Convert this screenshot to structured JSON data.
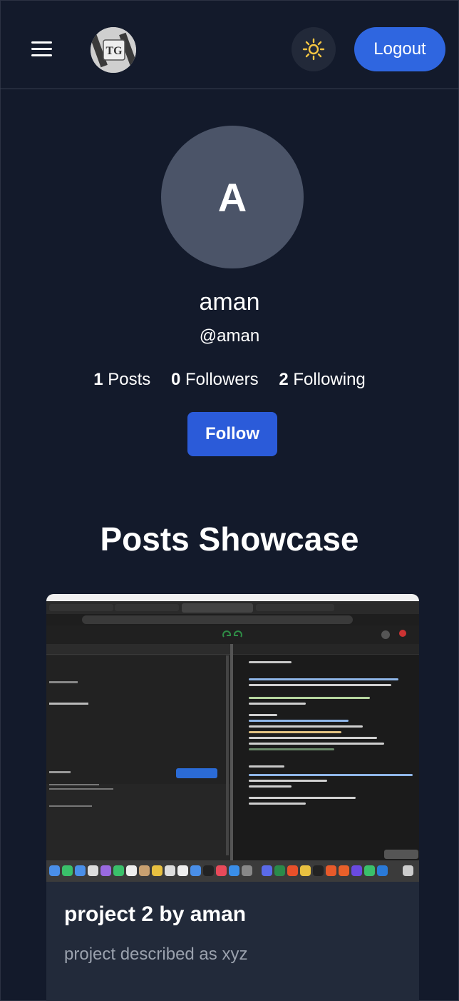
{
  "header": {
    "logo_text": "TG",
    "logout_label": "Logout"
  },
  "profile": {
    "avatar_letter": "A",
    "name": "aman",
    "handle": "@aman",
    "stats": {
      "posts_count": "1",
      "posts_label": "Posts",
      "followers_count": "0",
      "followers_label": "Followers",
      "following_count": "2",
      "following_label": "Following"
    },
    "follow_label": "Follow"
  },
  "posts": {
    "section_title": "Posts Showcase",
    "items": [
      {
        "title": "project 2 by aman",
        "description": "project described as xyz"
      }
    ]
  },
  "icons": {
    "menu": "hamburger-menu-icon",
    "theme": "sun-icon"
  },
  "colors": {
    "background": "#131a2b",
    "primary": "#2f66e0",
    "follow": "#2b5bd9",
    "card": "#222a3a",
    "avatar": "#4b5468",
    "sun": "#f5c542"
  }
}
